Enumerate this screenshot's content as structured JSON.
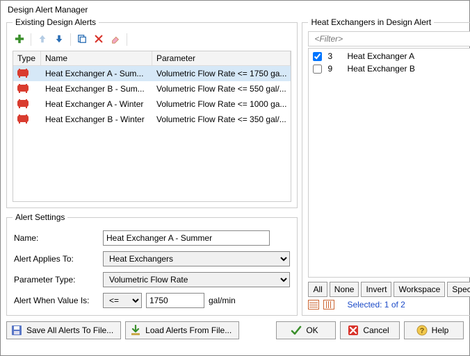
{
  "window": {
    "title": "Design Alert Manager"
  },
  "existing": {
    "legend": "Existing Design Alerts",
    "headers": {
      "type": "Type",
      "name": "Name",
      "parameter": "Parameter"
    },
    "rows": [
      {
        "name": "Heat Exchanger A - Sum...",
        "parameter": "Volumetric Flow Rate <= 1750 ga...",
        "selected": true
      },
      {
        "name": "Heat Exchanger B - Sum...",
        "parameter": "Volumetric Flow Rate <= 550 gal/...",
        "selected": false
      },
      {
        "name": "Heat Exchanger A - Winter",
        "parameter": "Volumetric Flow Rate <= 1000 ga...",
        "selected": false
      },
      {
        "name": "Heat Exchanger B - Winter",
        "parameter": "Volumetric Flow Rate <= 350 gal/...",
        "selected": false
      }
    ]
  },
  "settings": {
    "legend": "Alert Settings",
    "labels": {
      "name": "Name:",
      "applies": "Alert Applies To:",
      "paramType": "Parameter Type:",
      "when": "Alert When Value Is:"
    },
    "name": "Heat Exchanger A - Summer",
    "applies": "Heat Exchangers",
    "paramType": "Volumetric Flow Rate",
    "operator": "<=",
    "value": "1750",
    "unit": "gal/min"
  },
  "right": {
    "legend": "Heat Exchangers in Design Alert",
    "filterPlaceholder": "<Filter>",
    "items": [
      {
        "id": "3",
        "name": "Heat Exchanger A",
        "checked": true
      },
      {
        "id": "9",
        "name": "Heat Exchanger B",
        "checked": false
      }
    ],
    "buttons": {
      "all": "All",
      "none": "None",
      "invert": "Invert",
      "workspace": "Workspace",
      "special": "Special..."
    },
    "selectedText": "Selected: 1 of 2"
  },
  "bottom": {
    "saveAll": "Save All Alerts To File...",
    "load": "Load Alerts From File...",
    "ok": "OK",
    "cancel": "Cancel",
    "help": "Help"
  }
}
